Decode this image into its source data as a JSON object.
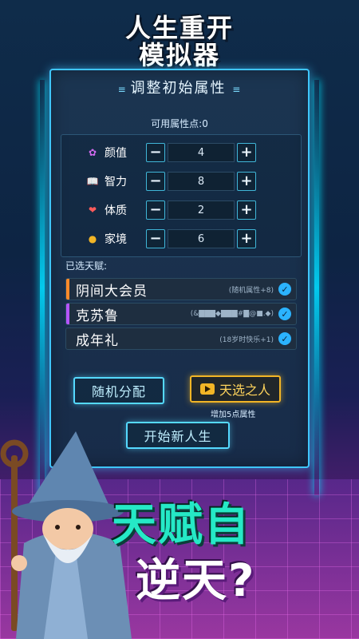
{
  "title": {
    "line1": "人生重开",
    "line2": "模拟器"
  },
  "panel": {
    "header": "调整初始属性",
    "points_label": "可用属性点:0",
    "attributes": [
      {
        "name": "颜值",
        "value": "4",
        "icon": "bow-icon",
        "color": "#d26bf0"
      },
      {
        "name": "智力",
        "value": "8",
        "icon": "book-icon",
        "color": "#f3f3f3"
      },
      {
        "name": "体质",
        "value": "2",
        "icon": "heart-icon",
        "color": "#ff5b5b"
      },
      {
        "name": "家境",
        "value": "6",
        "icon": "coin-icon",
        "color": "#f2b526"
      }
    ],
    "minus": "−",
    "plus": "+",
    "talents_title": "已选天赋:",
    "talents": [
      {
        "name": "阴间大会员",
        "desc": "(随机属性+8)",
        "accent": "#ff8a2a"
      },
      {
        "name": "克苏鲁",
        "desc": "(&▇▇▇◆▇▇▇#▇@■.◆)",
        "accent": "#b455ff"
      },
      {
        "name": "成年礼",
        "desc": "(18岁时快乐+1)",
        "accent": "#1e2e40"
      }
    ],
    "check": "✓",
    "buttons": {
      "random": "随机分配",
      "chosen": "天选之人",
      "chosen_note": "增加5点属性",
      "start": "开始新人生"
    }
  },
  "slogan": {
    "line1": "天赋自",
    "line2": "逆天?"
  }
}
